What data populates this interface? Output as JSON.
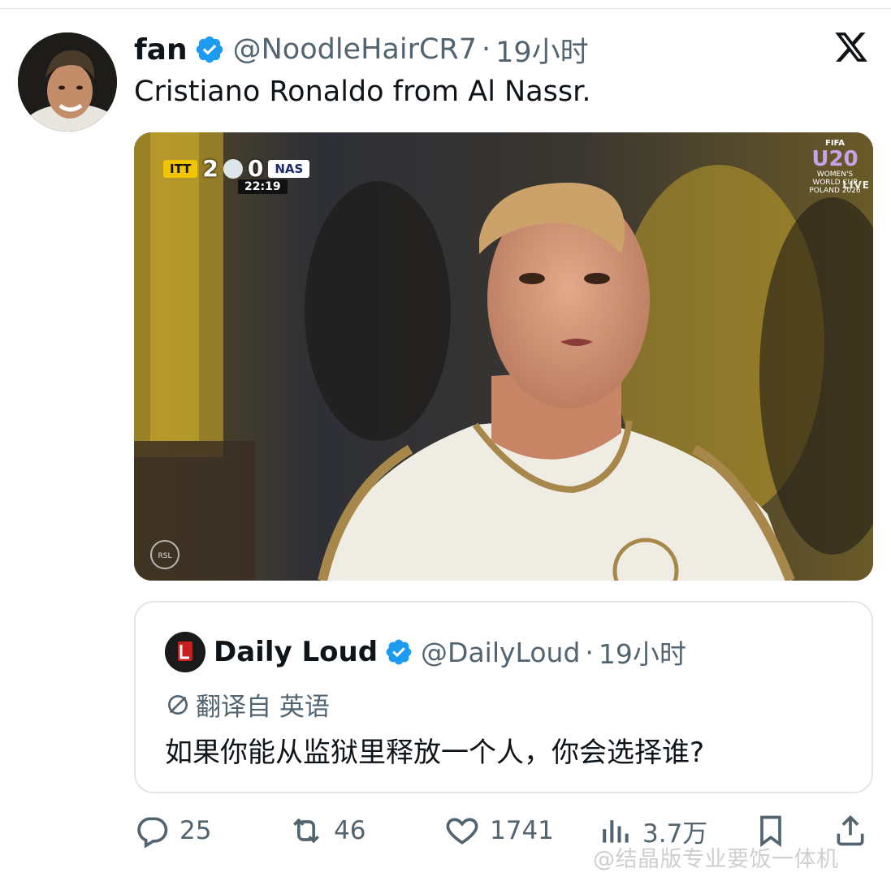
{
  "tweet": {
    "display_name": "fan",
    "handle": "@NoodleHairCR7",
    "time": "19小时",
    "separator": "·",
    "text": "Cristiano Ronaldo from Al Nassr."
  },
  "media": {
    "scoreboard": {
      "home_team": "ITT",
      "home_score": "2",
      "away_score": "0",
      "away_team": "NAS",
      "clock": "22:19"
    },
    "badge_top": "FIFA",
    "badge_main": "U20",
    "badge_sub": "WOMEN'S WORLD CUP POLAND 2026",
    "live": "LIVE",
    "league_logo": "RSL"
  },
  "quote": {
    "display_name": "Daily Loud",
    "handle": "@DailyLoud",
    "separator": "·",
    "time": "19小时",
    "translate_label": "翻译自 英语",
    "text": "如果你能从监狱里释放一个人，你会选择谁?"
  },
  "actions": {
    "replies": "25",
    "retweets": "46",
    "likes": "1741",
    "views": "3.7万"
  },
  "watermark": "@结晶版专业要饭一体机",
  "colors": {
    "verified_blue": "#1d9bf0",
    "secondary_text": "#536471",
    "primary_text": "#0f1419"
  }
}
